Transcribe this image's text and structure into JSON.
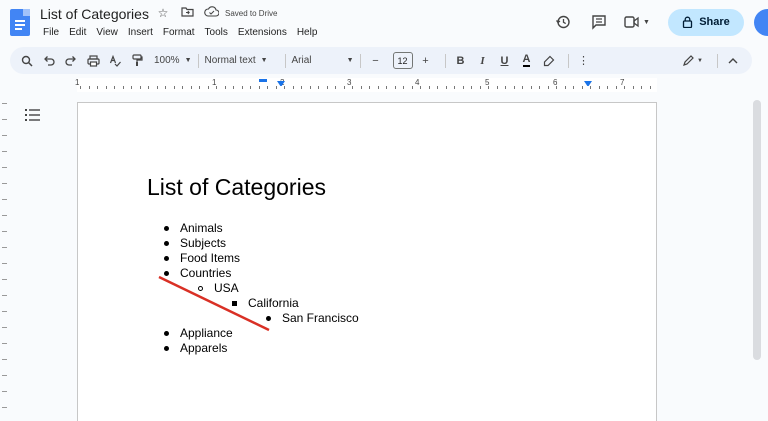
{
  "header": {
    "doc_title": "List of Categories",
    "saved_status": "Saved to Drive",
    "menu": [
      "File",
      "Edit",
      "View",
      "Insert",
      "Format",
      "Tools",
      "Extensions",
      "Help"
    ],
    "share_label": "Share",
    "icons": {
      "star": "star-icon",
      "move": "move-to-folder-icon",
      "cloud": "cloud-saved-icon",
      "history": "history-icon",
      "comments": "comments-icon",
      "meet": "meet-icon"
    }
  },
  "toolbar": {
    "zoom": "100%",
    "style": "Normal text",
    "font": "Arial",
    "font_size": "12",
    "minus": "−",
    "plus": "+",
    "bold": "B",
    "italic": "I",
    "underline": "U",
    "text_color": "A"
  },
  "ruler": {
    "numbers": [
      "1",
      "1",
      "2",
      "3",
      "4",
      "5",
      "6",
      "7"
    ]
  },
  "document": {
    "heading": "List of Categories",
    "items": [
      {
        "level": 1,
        "text": "Animals"
      },
      {
        "level": 1,
        "text": "Subjects"
      },
      {
        "level": 1,
        "text": "Food Items"
      },
      {
        "level": 1,
        "text": "Countries"
      },
      {
        "level": 2,
        "text": "USA"
      },
      {
        "level": 3,
        "text": "California"
      },
      {
        "level": 4,
        "text": "San Francisco"
      },
      {
        "level": 1,
        "text": "Appliance"
      },
      {
        "level": 1,
        "text": "Apparels"
      }
    ]
  },
  "colors": {
    "share_bg": "#c2e7ff",
    "toolbar_bg": "#edf2fa",
    "annotation_line": "#d93025",
    "docs_blue": "#4285f4"
  }
}
